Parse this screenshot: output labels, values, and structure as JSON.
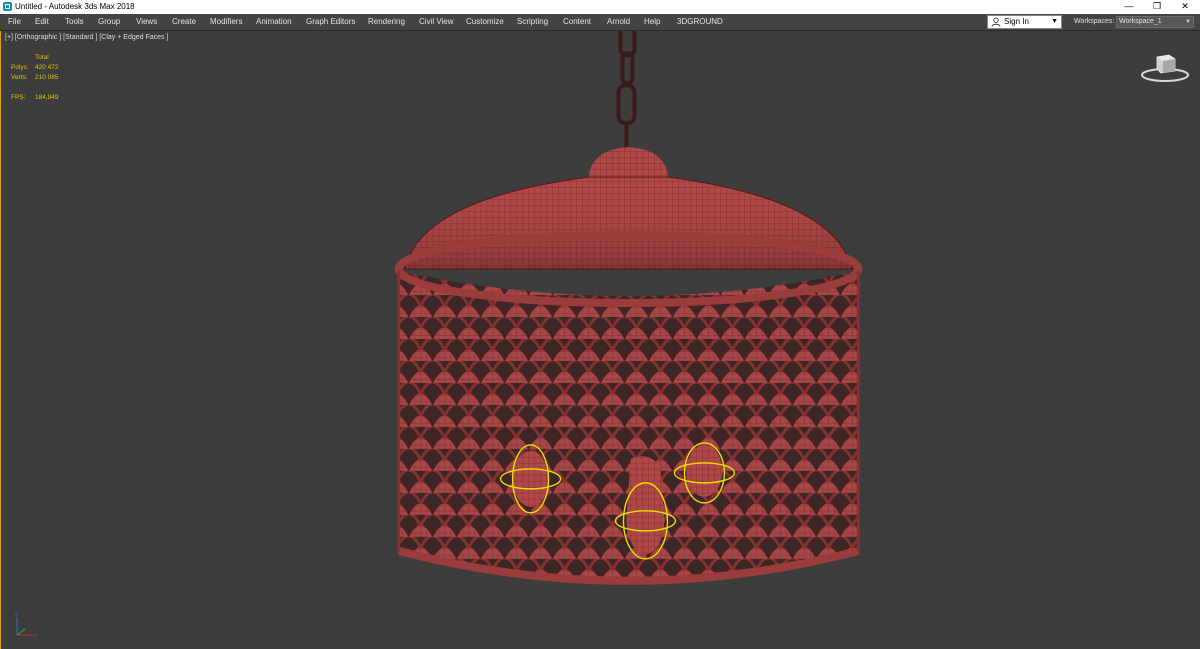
{
  "window": {
    "title": "Untitled - Autodesk 3ds Max 2018",
    "minimize_glyph": "—",
    "restore_glyph": "❐",
    "close_glyph": "✕"
  },
  "menu": {
    "items": [
      "File",
      "Edit",
      "Tools",
      "Group",
      "Views",
      "Create",
      "Modifiers",
      "Animation",
      "Graph Editors",
      "Rendering",
      "Civil View",
      "Customize",
      "Scripting",
      "Content",
      "Arnold",
      "Help",
      "3DGROUND"
    ],
    "sign_in": "Sign In",
    "workspaces_label": "Workspaces:",
    "workspace_value": "Workspace_1"
  },
  "viewport": {
    "label": "[+] [Orthographic ] [Standard ] [Clay + Edged Faces ]",
    "stats": {
      "header": "Total",
      "polys_label": "Polys:",
      "polys_value": "420 472",
      "verts_label": "Verts:",
      "verts_value": "210 085",
      "fps_label": "FPS:",
      "fps_value": "184,949"
    },
    "model": "pendant-lamp-wireframe",
    "mesh_color": "#b04848",
    "wire_color": "#6a1a1a",
    "selection_color": "#e8e000",
    "border_color": "#d9a400"
  },
  "icons": {
    "app": "3dsmax-app-icon",
    "user": "user-icon",
    "viewcube": "viewcube-icon",
    "axis": "axis-tripod-icon"
  }
}
